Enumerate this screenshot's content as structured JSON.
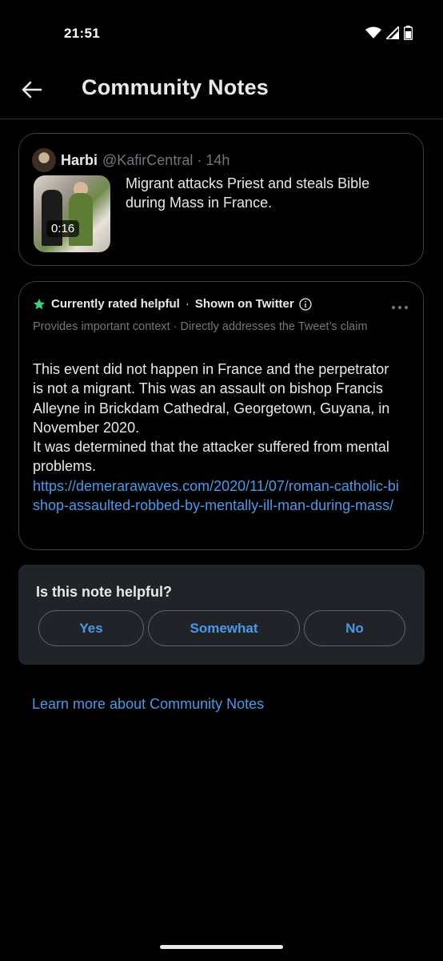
{
  "status_bar": {
    "time": "21:51"
  },
  "header": {
    "title": "Community Notes"
  },
  "tweet": {
    "author_name": "Harbi",
    "author_handle": "@KafirCentral",
    "separator": "·",
    "time": "14h",
    "video_duration": "0:16",
    "text": "Migrant attacks Priest and steals Bible during Mass in France."
  },
  "note": {
    "status": "Currently rated helpful",
    "separator": "·",
    "shown_on": "Shown on Twitter",
    "reasons": "Provides important context · Directly addresses the Tweet’s claim",
    "body_part1": "This event did not happen in France and the perpetrator is not a migrant. This was an assault on bishop Francis Alleyne in Brickdam Cathedral, Georgetown, Guyana, in November 2020.",
    "body_part2": "It was determined that the attacker suffered from mental problems.",
    "link": "https://demerarawaves.com/2020/11/07/roman-catholic-bishop-assaulted-robbed-by-mentally-ill-man-during-mass/"
  },
  "rating": {
    "question": "Is this note helpful?",
    "yes": "Yes",
    "somewhat": "Somewhat",
    "no": "No"
  },
  "footer": {
    "learn_more": "Learn more about Community Notes"
  },
  "colors": {
    "accent": "#4a99e9",
    "helpful_star": "#3ecf7c",
    "background": "#000000",
    "secondary_text": "#71767b"
  }
}
